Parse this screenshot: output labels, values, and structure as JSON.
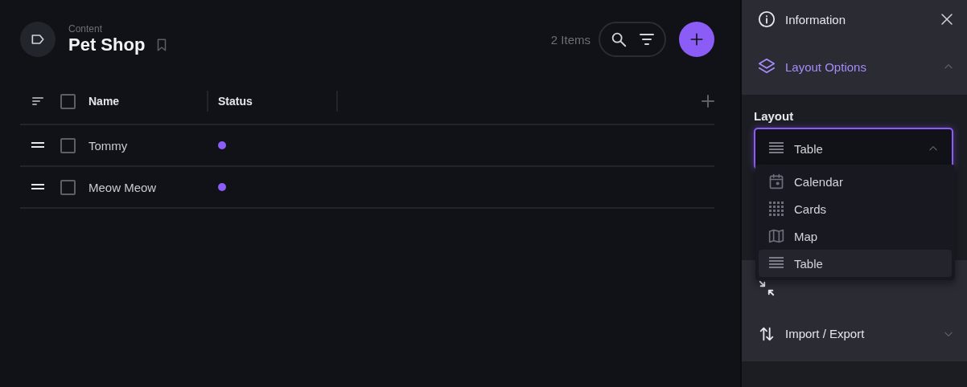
{
  "header": {
    "breadcrumb": "Content",
    "title": "Pet Shop",
    "item_count": "2 Items"
  },
  "table": {
    "all_checked": false,
    "columns": [
      "Name",
      "Status"
    ],
    "rows": [
      {
        "name": "Tommy",
        "checked": false,
        "color": "#8b5cf6"
      },
      {
        "name": "Meow Meow",
        "checked": false,
        "color": "#8b5cf6"
      }
    ]
  },
  "sidebar": {
    "sections": [
      {
        "kind": "info",
        "label": "Information"
      },
      {
        "kind": "layout",
        "label": "Layout Options",
        "expanded": true
      }
    ],
    "layout_field": {
      "label": "Layout",
      "value": "Table",
      "open": true,
      "options": [
        {
          "kind": "calendar",
          "label": "Calendar",
          "selected": false
        },
        {
          "kind": "cards",
          "label": "Cards",
          "selected": false
        },
        {
          "kind": "map",
          "label": "Map",
          "selected": false
        },
        {
          "kind": "table",
          "label": "Table",
          "selected": true
        }
      ]
    },
    "lower_sections": [
      {
        "kind": "refresh"
      },
      {
        "kind": "import",
        "label": "Import / Export",
        "expanded": false
      }
    ]
  }
}
